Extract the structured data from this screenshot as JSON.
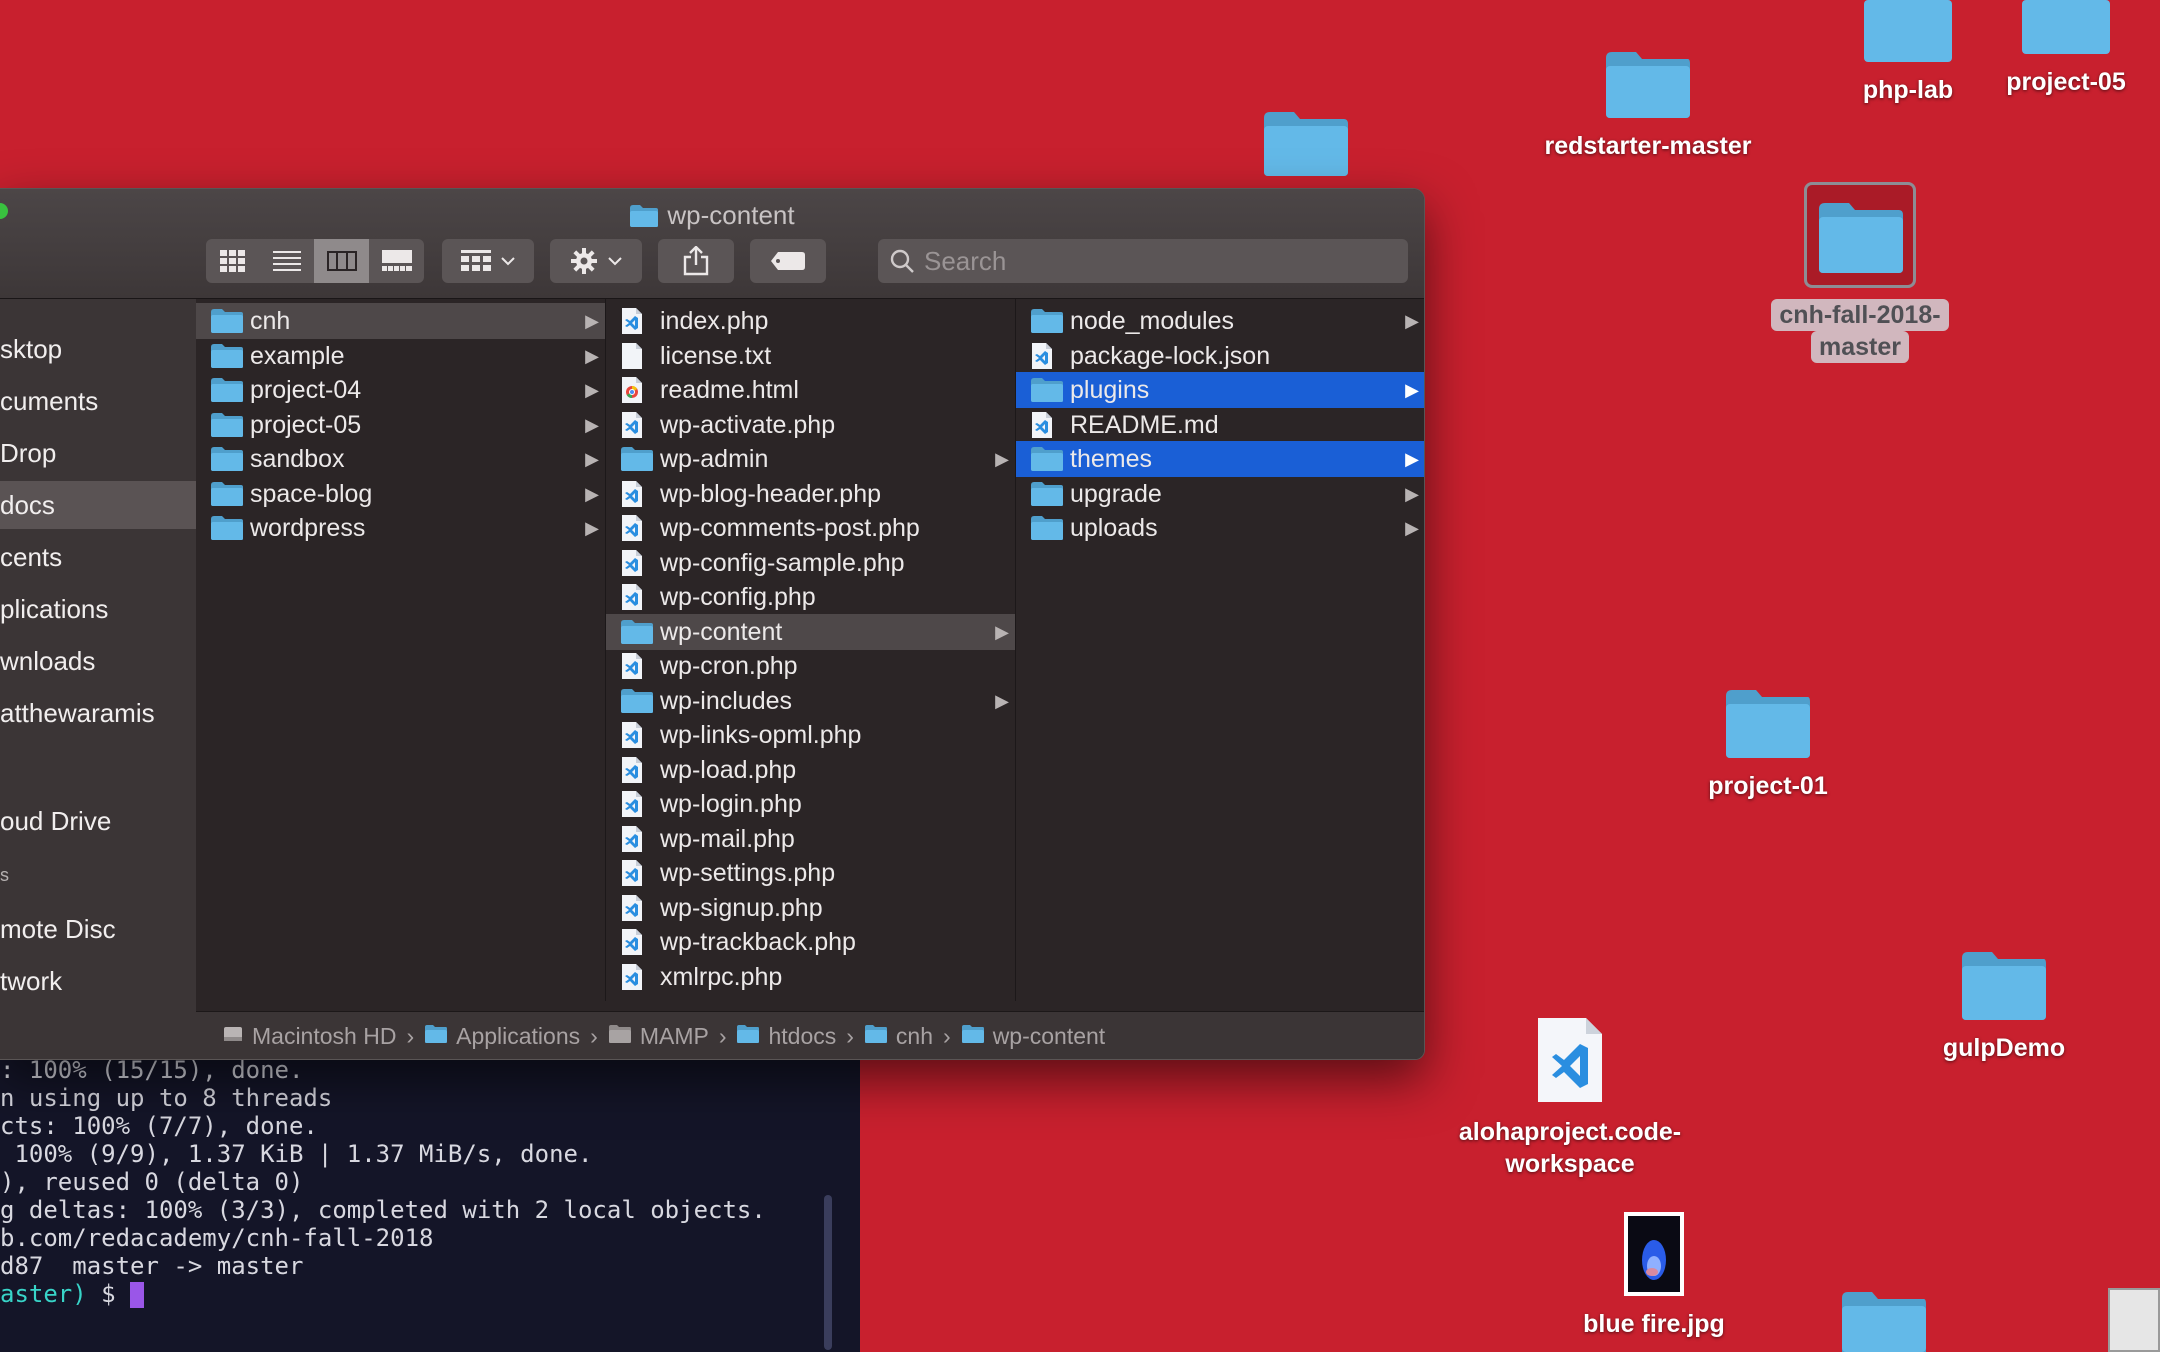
{
  "window": {
    "title": "wp-content"
  },
  "toolbar": {
    "view_icon": "icon-grid-icon",
    "list_icon": "list-icon",
    "column_icon": "column-view-icon",
    "gallery_icon": "gallery-icon",
    "group_icon": "group-by-icon",
    "action_icon": "gear-icon",
    "share_icon": "share-icon",
    "tag_icon": "tag-icon"
  },
  "search": {
    "placeholder": "Search"
  },
  "sidebar": {
    "items": [
      {
        "label": "sktop"
      },
      {
        "label": "cuments"
      },
      {
        "label": "Drop"
      },
      {
        "label": "docs",
        "selected": true
      },
      {
        "label": "cents"
      },
      {
        "label": "plications"
      },
      {
        "label": "wnloads"
      },
      {
        "label": "atthewaramis"
      },
      {
        "label": "oud Drive"
      },
      {
        "label": "s"
      },
      {
        "label": "mote Disc"
      },
      {
        "label": "twork"
      }
    ]
  },
  "columns": [
    {
      "items": [
        {
          "name": "cnh",
          "type": "folder",
          "arrow": true,
          "selected": "gray"
        },
        {
          "name": "example",
          "type": "folder",
          "arrow": true
        },
        {
          "name": "project-04",
          "type": "folder",
          "arrow": true
        },
        {
          "name": "project-05",
          "type": "folder",
          "arrow": true
        },
        {
          "name": "sandbox",
          "type": "folder",
          "arrow": true
        },
        {
          "name": "space-blog",
          "type": "folder",
          "arrow": true
        },
        {
          "name": "wordpress",
          "type": "folder",
          "arrow": true
        }
      ]
    },
    {
      "items": [
        {
          "name": "index.php",
          "type": "code"
        },
        {
          "name": "license.txt",
          "type": "text"
        },
        {
          "name": "readme.html",
          "type": "html"
        },
        {
          "name": "wp-activate.php",
          "type": "code"
        },
        {
          "name": "wp-admin",
          "type": "folder",
          "arrow": true
        },
        {
          "name": "wp-blog-header.php",
          "type": "code"
        },
        {
          "name": "wp-comments-post.php",
          "type": "code"
        },
        {
          "name": "wp-config-sample.php",
          "type": "code"
        },
        {
          "name": "wp-config.php",
          "type": "code"
        },
        {
          "name": "wp-content",
          "type": "folder",
          "arrow": true,
          "selected": "gray"
        },
        {
          "name": "wp-cron.php",
          "type": "code"
        },
        {
          "name": "wp-includes",
          "type": "folder",
          "arrow": true
        },
        {
          "name": "wp-links-opml.php",
          "type": "code"
        },
        {
          "name": "wp-load.php",
          "type": "code"
        },
        {
          "name": "wp-login.php",
          "type": "code"
        },
        {
          "name": "wp-mail.php",
          "type": "code"
        },
        {
          "name": "wp-settings.php",
          "type": "code"
        },
        {
          "name": "wp-signup.php",
          "type": "code"
        },
        {
          "name": "wp-trackback.php",
          "type": "code"
        },
        {
          "name": "xmlrpc.php",
          "type": "code"
        }
      ]
    },
    {
      "items": [
        {
          "name": "node_modules",
          "type": "folder",
          "arrow": true
        },
        {
          "name": "package-lock.json",
          "type": "code"
        },
        {
          "name": "plugins",
          "type": "folder",
          "arrow": true,
          "selected": "blue"
        },
        {
          "name": "README.md",
          "type": "code"
        },
        {
          "name": "themes",
          "type": "folder",
          "arrow": true,
          "selected": "blue"
        },
        {
          "name": "upgrade",
          "type": "folder",
          "arrow": true
        },
        {
          "name": "uploads",
          "type": "folder",
          "arrow": true
        }
      ]
    }
  ],
  "pathbar": [
    {
      "label": "Macintosh HD",
      "icon": "hard-drive-icon"
    },
    {
      "label": "Applications",
      "icon": "folder-icon"
    },
    {
      "label": "MAMP",
      "icon": "folder-icon"
    },
    {
      "label": "htdocs",
      "icon": "folder-icon"
    },
    {
      "label": "cnh",
      "icon": "folder-icon"
    },
    {
      "label": "wp-content",
      "icon": "folder-icon"
    }
  ],
  "terminal": {
    "lines": [
      ": 100% (15/15), done.",
      "n using up to 8 threads",
      "cts: 100% (7/7), done.",
      " 100% (9/9), 1.37 KiB | 1.37 MiB/s, done.",
      "), reused 0 (delta 0)",
      "g deltas: 100% (3/3), completed with 2 local objects.",
      "b.com/redacademy/cnh-fall-2018",
      "d87  master -> master"
    ],
    "prompt_branch": "aster)",
    "prompt_symbol": " $ "
  },
  "desktop": {
    "items": [
      {
        "label": "php-lab"
      },
      {
        "label": "project-05"
      },
      {
        "label": "redstarter-master"
      },
      {
        "label": "cnh-fall-2018-master",
        "label_line1": "cnh-fall-2018-",
        "label_line2": "master",
        "selected": true
      },
      {
        "label": "project-01"
      },
      {
        "label": "gulpDemo"
      },
      {
        "label": "alohaproject.code-workspace",
        "label_line1": "alohaproject.code-",
        "label_line2": "workspace"
      },
      {
        "label": "blue fire.jpg"
      }
    ]
  },
  "colors": {
    "desktop_bg": "#c8202e",
    "selection_blue": "#1a5fd6",
    "folder_blue": "#5cb5e6",
    "terminal_bg": "#141528",
    "terminal_accent": "#38d4c8"
  }
}
